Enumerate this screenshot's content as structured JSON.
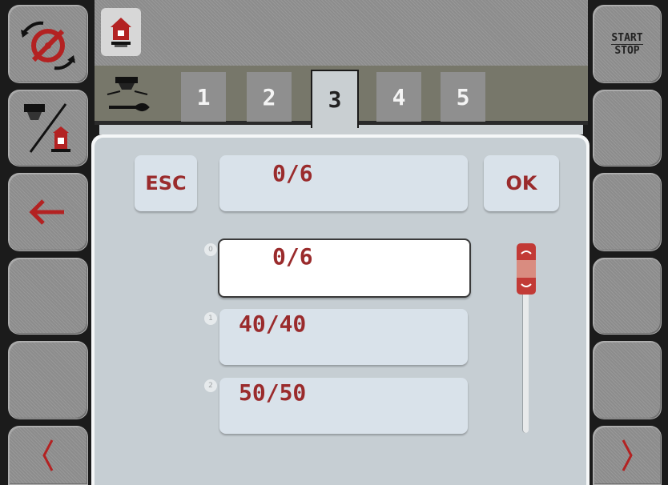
{
  "tabs": [
    {
      "label": "1",
      "active": false
    },
    {
      "label": "2",
      "active": false
    },
    {
      "label": "3",
      "active": true
    },
    {
      "label": "4",
      "active": false
    },
    {
      "label": "5",
      "active": false
    }
  ],
  "dialog": {
    "esc_label": "ESC",
    "ok_label": "OK",
    "current_value": "0/6"
  },
  "list": {
    "items": [
      {
        "index": "0",
        "value": "0/6",
        "selected": true
      },
      {
        "index": "1",
        "value": "40/40",
        "selected": false
      },
      {
        "index": "2",
        "value": "50/50",
        "selected": false
      }
    ]
  },
  "right_panel": {
    "start_label": "START",
    "stop_label": "STOP"
  },
  "colors": {
    "accent_red": "#9a2b2c",
    "panel_bg": "#c6ced3",
    "box_bg": "#d9e2ea"
  }
}
